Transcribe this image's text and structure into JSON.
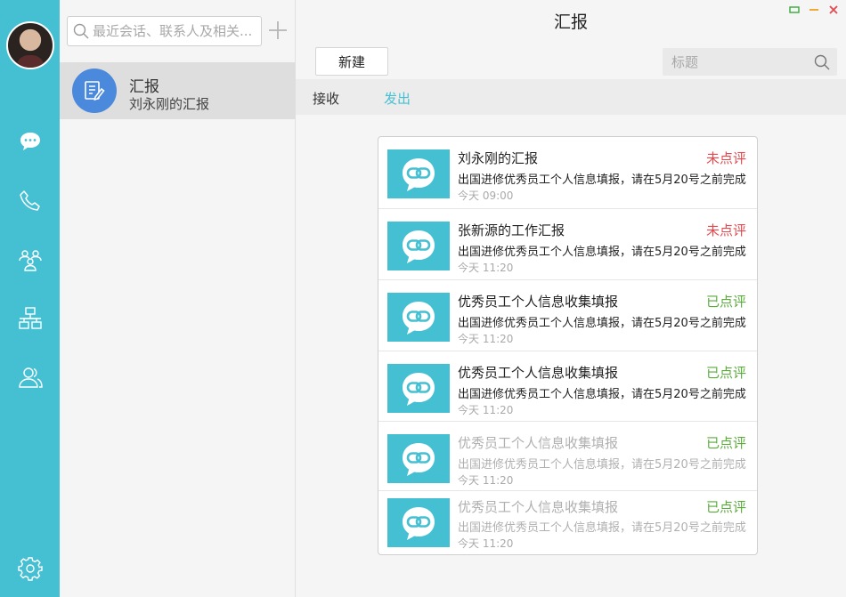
{
  "sidebar": {
    "icons": [
      "chat-icon",
      "phone-icon",
      "contacts-icon",
      "org-chart-icon",
      "group-icon",
      "settings-icon"
    ]
  },
  "sessions": {
    "search_placeholder": "最近会话、联系人及相关...",
    "items": [
      {
        "title": "汇报",
        "subtitle": "刘永刚的汇报"
      }
    ]
  },
  "main": {
    "title": "汇报",
    "new_button": "新建",
    "title_search_placeholder": "标题",
    "tabs": [
      {
        "label": "接收",
        "active": false
      },
      {
        "label": "发出",
        "active": true
      }
    ],
    "reports": [
      {
        "title": "刘永刚的汇报",
        "status": "未点评",
        "desc": "出国进修优秀员工个人信息填报，请在5月20号之前完成",
        "time": "今天 09:00"
      },
      {
        "title": "张新源的工作汇报",
        "status": "未点评",
        "desc": "出国进修优秀员工个人信息填报，请在5月20号之前完成",
        "time": "今天  11:20"
      },
      {
        "title": "优秀员工个人信息收集填报",
        "status": "已点评",
        "desc": "出国进修优秀员工个人信息填报，请在5月20号之前完成",
        "time": "今天  11:20"
      },
      {
        "title": "优秀员工个人信息收集填报",
        "status": "已点评",
        "desc": "出国进修优秀员工个人信息填报，请在5月20号之前完成",
        "time": "今天  11:20"
      },
      {
        "title": "优秀员工个人信息收集填报",
        "status": "已点评",
        "desc": "出国进修优秀员工个人信息填报，请在5月20号之前完成",
        "time": "今天  11:20"
      },
      {
        "title": "优秀员工个人信息收集填报",
        "status": "已点评",
        "desc": "出国进修优秀员工个人信息填报，请在5月20号之前完成",
        "time": "今天  11:20"
      }
    ]
  },
  "colors": {
    "accent": "#45c0d3",
    "unrated": "#e5484d",
    "rated": "#5aab3b",
    "session_avatar": "#4a89dc"
  }
}
